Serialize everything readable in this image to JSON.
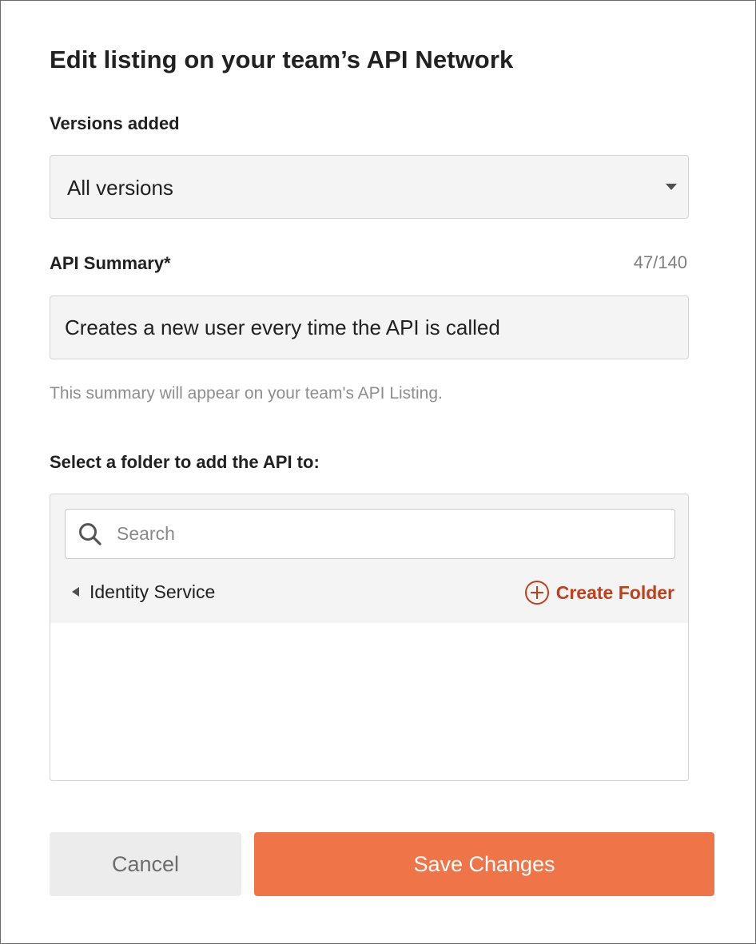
{
  "dialog": {
    "title": "Edit listing on your team’s API Network"
  },
  "versions": {
    "label": "Versions added",
    "selected": "All versions",
    "caret_icon": "caret-down-icon"
  },
  "summary": {
    "label": "API Summary*",
    "counter": "47/140",
    "value": "Creates a new user every time the API is called",
    "helper": "This summary will appear on your team's API Listing."
  },
  "folder": {
    "label": "Select a folder to add the API to:",
    "search_placeholder": "Search",
    "search_icon": "search-icon",
    "items": [
      {
        "label": "Identity Service",
        "icon": "caret-left-icon"
      }
    ],
    "create_label": "Create Folder",
    "create_icon": "plus-circle-icon",
    "accent_color": "#c0401c"
  },
  "actions": {
    "cancel_label": "Cancel",
    "save_label": "Save Changes",
    "save_color": "#ef7549"
  }
}
